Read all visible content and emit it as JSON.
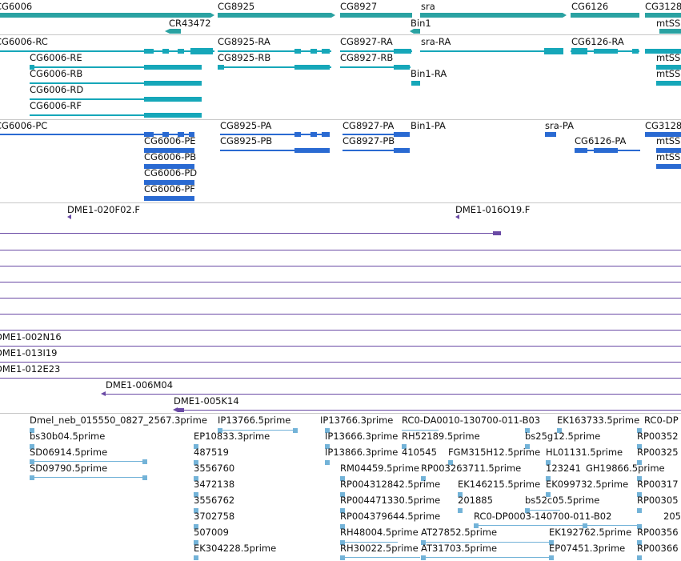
{
  "colors": {
    "gene": "#2aa2a2",
    "ncrna": "#2aa2a2",
    "transcript_teal": "#16a7b9",
    "transcript_blue": "#2a6ad2",
    "clone": "#6a4aa5",
    "est": "#73b3d8",
    "separator": "#c8c8c8"
  },
  "genes": [
    {
      "label": "CG6006"
    },
    {
      "label": "CG8925"
    },
    {
      "label": "CG8927"
    },
    {
      "label": "sra"
    },
    {
      "label": "CG6126"
    },
    {
      "label": "CG3128"
    },
    {
      "label": "CR43472"
    },
    {
      "label": "Bin1"
    },
    {
      "label": "mtSSB"
    }
  ],
  "rna_transcripts": [
    {
      "label": "CG6006-RC"
    },
    {
      "label": "CG8925-RA"
    },
    {
      "label": "CG8927-RA"
    },
    {
      "label": "sra-RA"
    },
    {
      "label": "CG6126-RA"
    },
    {
      "label": "mtSSB"
    },
    {
      "label": "CG6006-RE"
    },
    {
      "label": "CG8925-RB"
    },
    {
      "label": "CG8927-RB"
    },
    {
      "label": "mtSSB"
    },
    {
      "label": "CG6006-RB"
    },
    {
      "label": "Bin1-RA"
    },
    {
      "label": "CG6006-RD"
    },
    {
      "label": "CG6006-RF"
    }
  ],
  "protein_transcripts": [
    {
      "label": "CG6006-PC"
    },
    {
      "label": "CG8925-PA"
    },
    {
      "label": "CG8927-PA"
    },
    {
      "label": "Bin1-PA"
    },
    {
      "label": "sra-PA"
    },
    {
      "label": "CG3128"
    },
    {
      "label": "CG6006-PE"
    },
    {
      "label": "CG8925-PB"
    },
    {
      "label": "CG8927-PB"
    },
    {
      "label": "CG6126-PA"
    },
    {
      "label": "mtSSB"
    },
    {
      "label": "CG6006-PB"
    },
    {
      "label": "mtSSB"
    },
    {
      "label": "CG6006-PD"
    },
    {
      "label": "CG6006-PF"
    }
  ],
  "clones": [
    {
      "label": "DME1-020F02.F"
    },
    {
      "label": "DME1-016O19.F"
    },
    {
      "label": "DME1-002N16"
    },
    {
      "label": "DME1-013I19"
    },
    {
      "label": "DME1-012E23"
    },
    {
      "label": "DME1-006M04"
    },
    {
      "label": "DME1-005K14"
    }
  ],
  "ests": [
    {
      "label": "Dmel_neb_015550_0827_2567.3prime"
    },
    {
      "label": "IP13766.5prime"
    },
    {
      "label": "IP13766.3prime"
    },
    {
      "label": "RC0-DA0010-130700-011-B03"
    },
    {
      "label": "EK163733.5prime"
    },
    {
      "label": "RC0-DP"
    },
    {
      "label": "bs30b04.5prime"
    },
    {
      "label": "EP10833.3prime"
    },
    {
      "label": "IP13666.3prime"
    },
    {
      "label": "RH52189.5prime"
    },
    {
      "label": "bs25g12.5prime"
    },
    {
      "label": "RP00352"
    },
    {
      "label": "SD06914.5prime"
    },
    {
      "label": "487519"
    },
    {
      "label": "IP13866.3prime"
    },
    {
      "label": "410545"
    },
    {
      "label": "FGM315H12.5prime"
    },
    {
      "label": "HL01131.5prime"
    },
    {
      "label": "RP00325"
    },
    {
      "label": "SD09790.5prime"
    },
    {
      "label": "3556760"
    },
    {
      "label": "RM04459.5prime"
    },
    {
      "label": "RP003263711.5prime"
    },
    {
      "label": "123241"
    },
    {
      "label": "GH19866.5prime"
    },
    {
      "label": "3472138"
    },
    {
      "label": "RP004312842.5prime"
    },
    {
      "label": "EK146215.5prime"
    },
    {
      "label": "EK099732.5prime"
    },
    {
      "label": "RP00317"
    },
    {
      "label": "3556762"
    },
    {
      "label": "RP004471330.5prime"
    },
    {
      "label": "201885"
    },
    {
      "label": "bs52c05.5prime"
    },
    {
      "label": "RP00305"
    },
    {
      "label": "3702758"
    },
    {
      "label": "RP004379644.5prime"
    },
    {
      "label": "RC0-DP0003-140700-011-B02"
    },
    {
      "label": "205"
    },
    {
      "label": "507009"
    },
    {
      "label": "RH48004.5prime"
    },
    {
      "label": "AT27852.5prime"
    },
    {
      "label": "EK192762.5prime"
    },
    {
      "label": "RP00356"
    },
    {
      "label": "EK304228.5prime"
    },
    {
      "label": "RH30022.5prime"
    },
    {
      "label": "AT31703.5prime"
    },
    {
      "label": "EP07451.3prime"
    },
    {
      "label": "RP00366"
    }
  ]
}
